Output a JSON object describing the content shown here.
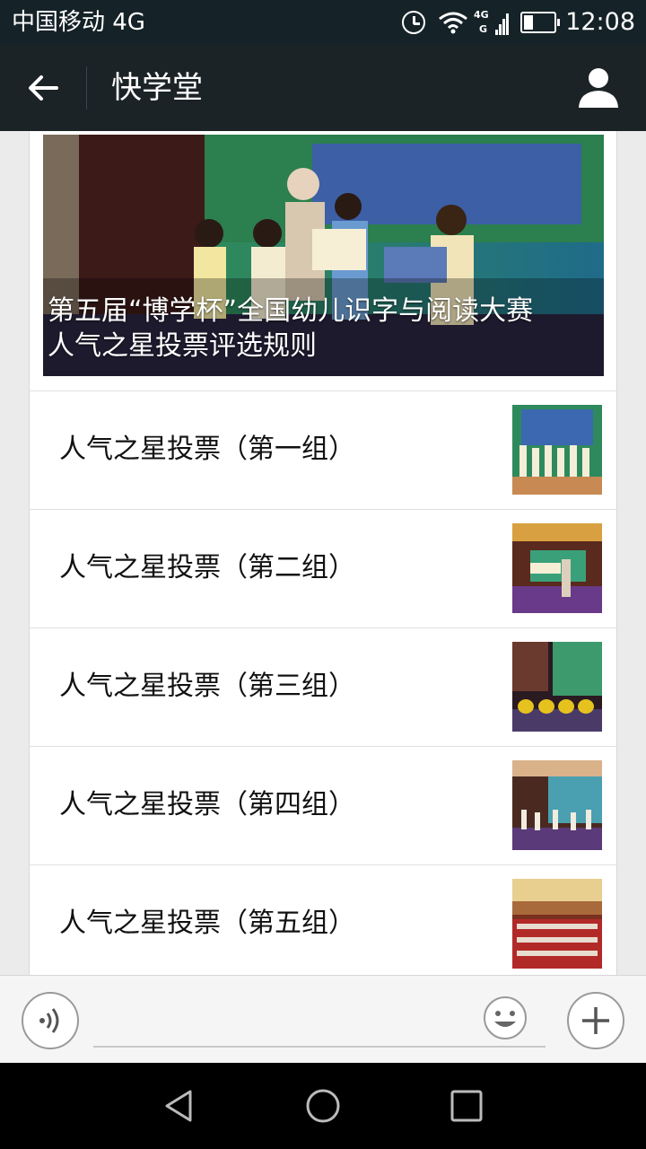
{
  "status_bar": {
    "carrier": "中国移动 4G",
    "network_badge_top": "4G",
    "network_badge_bottom": "G",
    "time": "12:08"
  },
  "app_bar": {
    "title": "快学堂",
    "back_icon": "arrow-left-icon",
    "profile_icon": "person-icon"
  },
  "cover": {
    "title_line1": "第五届“博学杯”全国幼儿识字与阅读大赛",
    "title_line2": "人气之星投票评选规则"
  },
  "articles": [
    {
      "title": "人气之星投票（第一组）"
    },
    {
      "title": "人气之星投票（第二组）"
    },
    {
      "title": "人气之星投票（第三组）"
    },
    {
      "title": "人气之星投票（第四组）"
    },
    {
      "title": "人气之星投票（第五组）"
    }
  ],
  "input_bar": {
    "voice_icon": "voice-icon",
    "emoji_icon": "smiley-icon",
    "plus_icon": "plus-icon",
    "text_value": ""
  },
  "nav_bar": {
    "icons": [
      "back-triangle-icon",
      "home-circle-icon",
      "recents-square-icon"
    ]
  },
  "colors": {
    "status_bar_bg": "#152228",
    "app_bar_bg": "#1c2327",
    "page_bg": "#ebebeb",
    "card_bg": "#ffffff"
  }
}
